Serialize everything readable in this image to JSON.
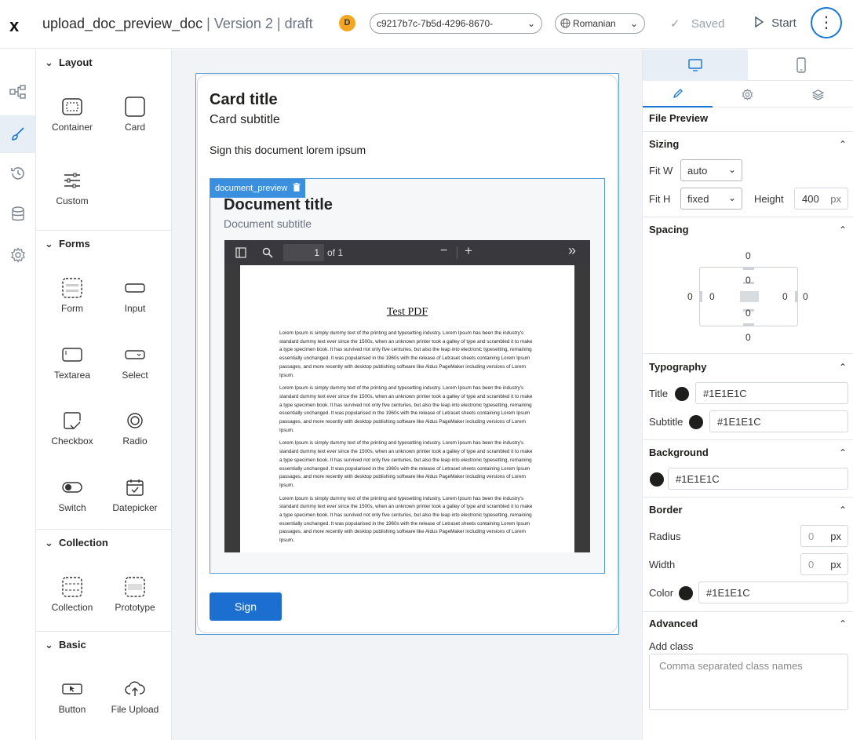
{
  "topbar": {
    "logo": "x",
    "doc_name": "upload_doc_preview_doc",
    "meta": "| Version 2 | draft",
    "avatar": "D",
    "id_select": "c9217b7c-7b5d-4296-8670-",
    "language": "Romanian",
    "saved": "Saved",
    "start": "Start"
  },
  "palette": {
    "sections": [
      {
        "title": "Layout",
        "items": [
          {
            "label": "Container",
            "icon": "container-icon"
          },
          {
            "label": "Card",
            "icon": "card-icon"
          },
          {
            "label": "Custom",
            "icon": "sliders-icon"
          }
        ]
      },
      {
        "title": "Forms",
        "items": [
          {
            "label": "Form",
            "icon": "form-icon"
          },
          {
            "label": "Input",
            "icon": "input-icon"
          },
          {
            "label": "Textarea",
            "icon": "textarea-icon"
          },
          {
            "label": "Select",
            "icon": "select-icon"
          },
          {
            "label": "Checkbox",
            "icon": "checkbox-icon"
          },
          {
            "label": "Radio",
            "icon": "radio-icon"
          },
          {
            "label": "Switch",
            "icon": "switch-icon"
          },
          {
            "label": "Datepicker",
            "icon": "calendar-icon"
          }
        ]
      },
      {
        "title": "Collection",
        "items": [
          {
            "label": "Collection",
            "icon": "collection-icon"
          },
          {
            "label": "Prototype",
            "icon": "prototype-icon"
          }
        ]
      },
      {
        "title": "Basic",
        "items": [
          {
            "label": "Button",
            "icon": "button-icon"
          },
          {
            "label": "File Upload",
            "icon": "upload-icon"
          }
        ]
      }
    ]
  },
  "canvas": {
    "card_title": "Card title",
    "card_subtitle": "Card subtitle",
    "card_text": "Sign this document lorem ipsum",
    "preview_tag": "document_preview",
    "doc_title": "Document title",
    "doc_subtitle": "Document subtitle",
    "pdf": {
      "page_value": "1",
      "page_of": "of 1",
      "heading": "Test PDF",
      "paragraph": "Lorem Ipsum is simply dummy text of the printing and typesetting industry. Lorem Ipsum has been the industry's standard dummy text ever since the 1500s, when an unknown printer took a galley of type and scrambled it to make a type specimen book. It has survived not only five centuries, but also the leap into electronic typesetting, remaining essentially unchanged. It was popularised in the 1960s with the release of Letraset sheets containing Lorem Ipsum passages, and more recently with desktop publishing software like Aldus PageMaker including versions of Lorem Ipsum."
    },
    "sign_button": "Sign"
  },
  "props": {
    "component": "File Preview",
    "sizing": {
      "title": "Sizing",
      "fit_w_label": "Fit W",
      "fit_w": "auto",
      "fit_h_label": "Fit H",
      "fit_h": "fixed",
      "height_label": "Height",
      "height": "400",
      "unit": "px"
    },
    "spacing": {
      "title": "Spacing",
      "m_top": "0",
      "m_bottom": "0",
      "m_left": "0",
      "m_right": "0",
      "p_top": "0",
      "p_bottom": "0",
      "p_left": "0",
      "p_right": "0"
    },
    "typography": {
      "title": "Typography",
      "title_label": "Title",
      "title_color": "#1E1E1C",
      "subtitle_label": "Subtitle",
      "subtitle_color": "#1E1E1C"
    },
    "background": {
      "title": "Background",
      "color": "#1E1E1C"
    },
    "border": {
      "title": "Border",
      "radius_label": "Radius",
      "radius": "0",
      "width_label": "Width",
      "width": "0",
      "unit": "px",
      "color_label": "Color",
      "color": "#1E1E1C"
    },
    "advanced": {
      "title": "Advanced",
      "class_label": "Add class",
      "class_placeholder": "Comma separated class names"
    }
  },
  "colors": {
    "accent": "#1976d2",
    "button": "#1c6fd1",
    "tag": "#3a8fde",
    "swatch": "#1E1E1C"
  }
}
